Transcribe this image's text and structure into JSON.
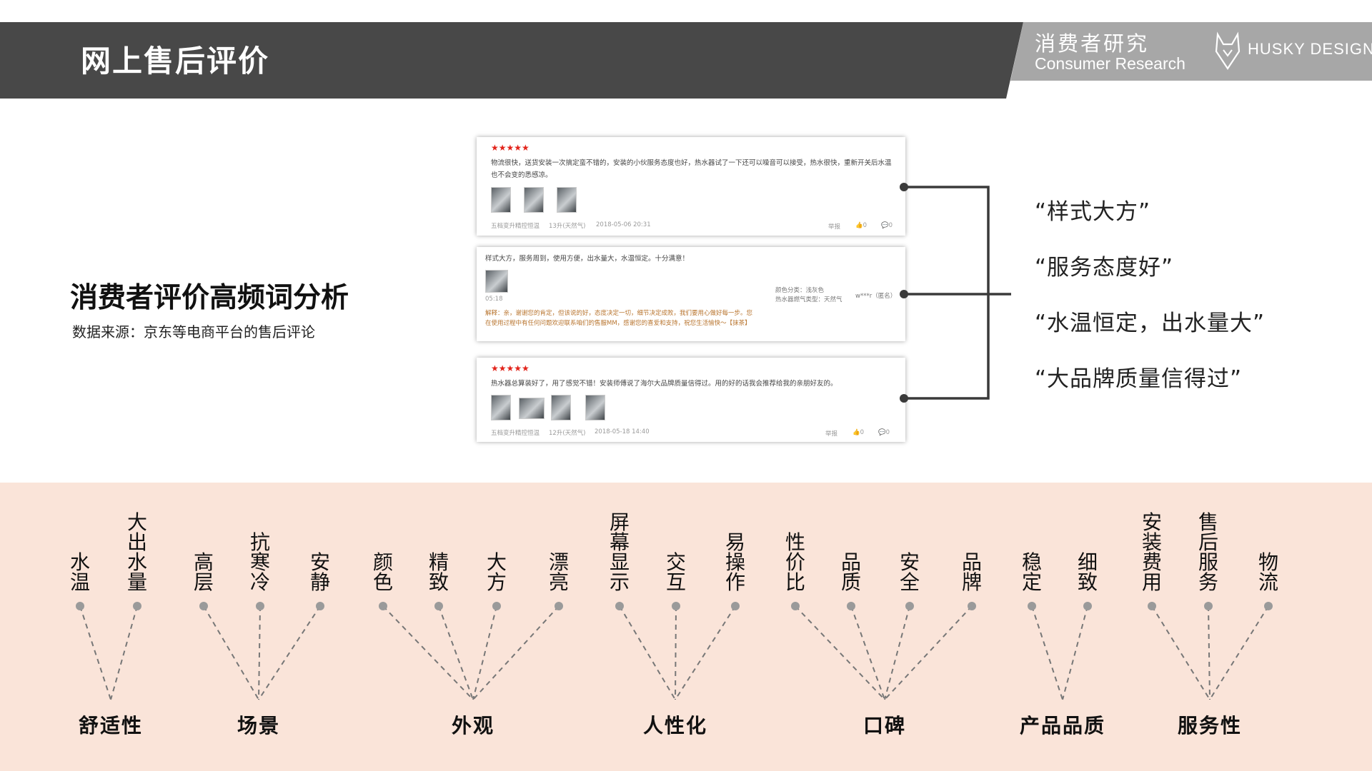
{
  "header": {
    "title": "网上售后评价",
    "research_cn": "消费者研究",
    "research_en": "Consumer Research",
    "brand": "HUSKY DESIGN"
  },
  "section": {
    "title": "消费者评价高频词分析",
    "source": "数据来源：京东等电商平台的售后评论"
  },
  "reviews": [
    {
      "stars": "★★★★★",
      "text": "物流很快，送货安装一次搞定蛮不错的，安装的小伙服务态度也好，热水器试了一下还可以噪音可以接受，热水很快，重新开关后水温也不会变的悉感凉。",
      "product": "五档变升精控恒温",
      "spec": "13升(天然气)",
      "date": "2018-05-06 20:31",
      "report": "举报",
      "likes": "0",
      "comments": "0"
    },
    {
      "text": "样式大方，服务周到，使用方便，出水量大，水温恒定。十分满意！",
      "time": "05:18",
      "color_label": "颜色分类：浅灰色",
      "gas_label": "热水器燃气类型：天然气",
      "user": "w***r（匿名）",
      "reply": "解释：亲，谢谢您的肯定，但该说的好，态度决定一切，细节决定成败，我们要用心做好每一步。您在使用过程中有任何问题欢迎联系咱们的售服MM，感谢您的喜爱和支持，祝您生活愉快～【抹茶】"
    },
    {
      "stars": "★★★★★",
      "text": "热水器总算装好了，用了感觉不错！安装师傅说了海尔大品牌质量信得过。用的好的话我会推荐给我的亲朋好友的。",
      "product": "五档变升精控恒温",
      "spec": "12升(天然气)",
      "date": "2018-05-18 14:40",
      "report": "举报",
      "likes": "0",
      "comments": "0"
    }
  ],
  "keywords": [
    "“样式大方”",
    "“服务态度好”",
    "“水温恒定，出水量大”",
    "“大品牌质量信得过”"
  ],
  "categories": [
    {
      "name": "舒适性",
      "words": [
        "水温",
        "大出水量"
      ]
    },
    {
      "name": "场景",
      "words": [
        "高层",
        "抗寒冷",
        "安静"
      ]
    },
    {
      "name": "外观",
      "words": [
        "颜色",
        "精致",
        "大方",
        "漂亮"
      ]
    },
    {
      "name": "人性化",
      "words": [
        "屏幕显示",
        "交互",
        "易操作"
      ]
    },
    {
      "name": "口碑",
      "words": [
        "性价比",
        "品质",
        "安全",
        "品牌"
      ]
    },
    {
      "name": "产品品质",
      "words": [
        "稳定",
        "细致"
      ]
    },
    {
      "name": "服务性",
      "words": [
        "安装费用",
        "售后服务",
        "物流"
      ]
    }
  ],
  "colors": {
    "header_dark": "#484848",
    "header_gray": "#a7a7a7",
    "panel_bg": "#fae4d9",
    "star_red": "#e2231a",
    "reply_orange": "#b8742e"
  }
}
